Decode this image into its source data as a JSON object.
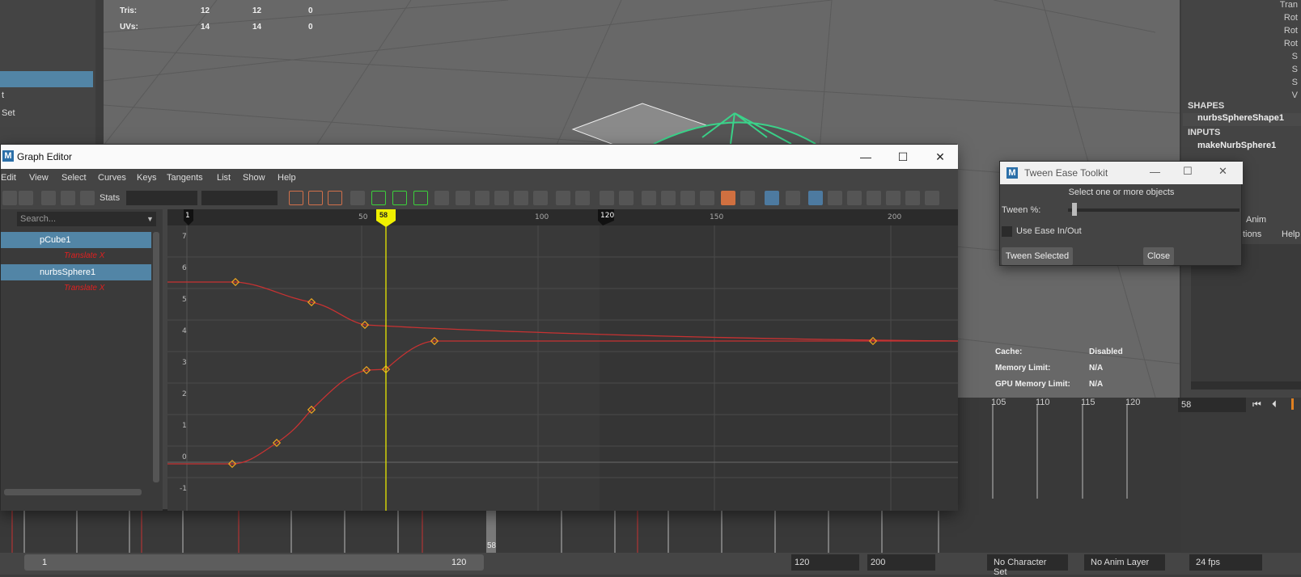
{
  "viewport": {
    "hud": {
      "rows": [
        {
          "label": "Tris:",
          "a": "12",
          "b": "12",
          "c": "0"
        },
        {
          "label": "UVs:",
          "a": "14",
          "b": "14",
          "c": "0"
        }
      ],
      "cache_label": "Cache:",
      "cache_value": "Disabled",
      "memory_label": "Memory Limit:",
      "memory_value": "N/A",
      "gpu_label": "GPU Memory Limit:",
      "gpu_value": "N/A"
    }
  },
  "left_panel": {
    "items": [
      "t",
      "Set"
    ]
  },
  "right_panel": {
    "attrs": [
      "Tran",
      "Rot",
      "Rot",
      "Rot",
      "S",
      "S",
      "S",
      "V"
    ],
    "shapes_header": "SHAPES",
    "shape_item": "nurbsSphereShape1",
    "inputs_header": "INPUTS",
    "input_item": "makeNurbSphere1",
    "tab_anim": "Anim",
    "menu_options": "tions",
    "menu_help": "Help"
  },
  "graph_editor": {
    "title": "Graph Editor",
    "menu": [
      "Edit",
      "View",
      "Select",
      "Curves",
      "Keys",
      "Tangents",
      "List",
      "Show",
      "Help"
    ],
    "stats_label": "Stats",
    "search_placeholder": "Search...",
    "outliner": [
      {
        "name": "pCube1",
        "channel": "Translate X"
      },
      {
        "name": "nurbsSphere1",
        "channel": "Translate X"
      }
    ],
    "current_frame": "58",
    "ruler_labels": [
      "1",
      "50",
      "100",
      "120",
      "150",
      "200"
    ],
    "y_labels": [
      "7",
      "6",
      "5",
      "4",
      "3",
      "2",
      "1",
      "0",
      "-1"
    ],
    "curve_color": "#c83232",
    "key_color": "#e8a020",
    "time_indicator_color": "#e6e600"
  },
  "tween": {
    "title": "Tween Ease Toolkit",
    "status": "Select one or more objects",
    "tween_label": "Tween %:",
    "tween_value": 0.02,
    "ease_label": "Use Ease In/Out",
    "ease_checked": false,
    "tween_button": "Tween Selected",
    "close_button": "Close"
  },
  "timeline": {
    "upper_ticks": [
      "105",
      "110",
      "115",
      "120"
    ],
    "current_frame_field": "58",
    "current_frame_marker": "58"
  },
  "range_bar": {
    "start": "1",
    "end": "120",
    "anim_start": "120",
    "anim_end": "200",
    "character_set": "No Character Set",
    "anim_layer": "No Anim Layer",
    "fps": "24 fps"
  }
}
